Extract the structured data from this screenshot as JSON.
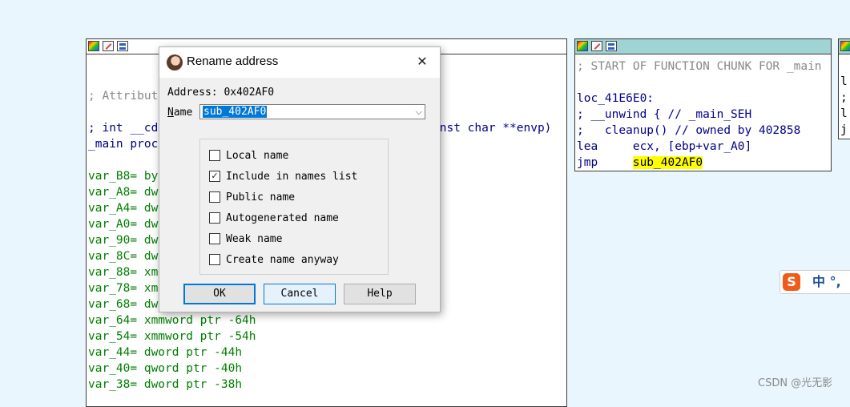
{
  "left_node": {
    "lines": [
      {
        "text": "",
        "cls": "black"
      },
      {
        "text": "",
        "cls": "black"
      },
      {
        "text": "; Attribut",
        "cls": "grey"
      },
      {
        "text": "",
        "cls": "black"
      },
      {
        "text": "; int __cd",
        "cls": "blue"
      },
      {
        "text": "_main proc",
        "cls": "blue"
      },
      {
        "text": "",
        "cls": "black"
      },
      {
        "text": "var_B8= by",
        "cls": "green"
      },
      {
        "text": "var_A8= dw",
        "cls": "green"
      },
      {
        "text": "var_A4= dw",
        "cls": "green"
      },
      {
        "text": "var_A0= dw",
        "cls": "green"
      },
      {
        "text": "var_90= dw",
        "cls": "green"
      },
      {
        "text": "var_8C= dw",
        "cls": "green"
      },
      {
        "text": "var_88= xm",
        "cls": "green"
      },
      {
        "text": "var_78= xm",
        "cls": "green"
      },
      {
        "text": "var_68= dw",
        "cls": "green"
      },
      {
        "text": "var_64= xmmword ptr -64h",
        "cls": "green"
      },
      {
        "text": "var_54= xmmword ptr -54h",
        "cls": "green"
      },
      {
        "text": "var_44= dword ptr -44h",
        "cls": "green"
      },
      {
        "text": "var_40= qword ptr -40h",
        "cls": "green"
      },
      {
        "text": "var_38= dword ptr -38h",
        "cls": "green"
      }
    ],
    "signature_tail": "onst char **envp)"
  },
  "right_node": {
    "lines": [
      {
        "text": "; START OF FUNCTION CHUNK FOR _main",
        "cls": "grey"
      },
      {
        "text": "",
        "cls": "black"
      },
      {
        "text": "loc_41E6E0:",
        "cls": "blue"
      },
      {
        "text": "; __unwind { // _main_SEH",
        "cls": "blue"
      },
      {
        "text": ";   cleanup() // owned by 402858",
        "cls": "blue"
      },
      {
        "text": "lea     ecx, [ebp+var_A0]",
        "cls": "navy"
      },
      {
        "text": "jmp     ",
        "cls": "navy"
      }
    ],
    "jmp_target": "sub_402AF0"
  },
  "far_right_node": {
    "lines": [
      "",
      "l",
      ";",
      "l",
      "j"
    ]
  },
  "dialog": {
    "title": "Rename address",
    "close_glyph": "✕",
    "address_text": "Address: 0x402AF0",
    "name_label_first": "N",
    "name_label_rest": "ame",
    "name_value": "sub_402AF0",
    "dropdown_glyph": "⌵",
    "checkboxes": [
      {
        "label": "Local name",
        "checked": false
      },
      {
        "label": "Include in names list",
        "checked": true
      },
      {
        "label": "Public name",
        "checked": false
      },
      {
        "label": "Autogenerated name",
        "checked": false
      },
      {
        "label": "Weak name",
        "checked": false
      },
      {
        "label": "Create name anyway",
        "checked": false
      }
    ],
    "buttons": {
      "ok": "OK",
      "cancel": "Cancel",
      "help": "Help"
    }
  },
  "ime": {
    "logo": "S",
    "text": "中 °,"
  },
  "watermark": "CSDN @光无影"
}
